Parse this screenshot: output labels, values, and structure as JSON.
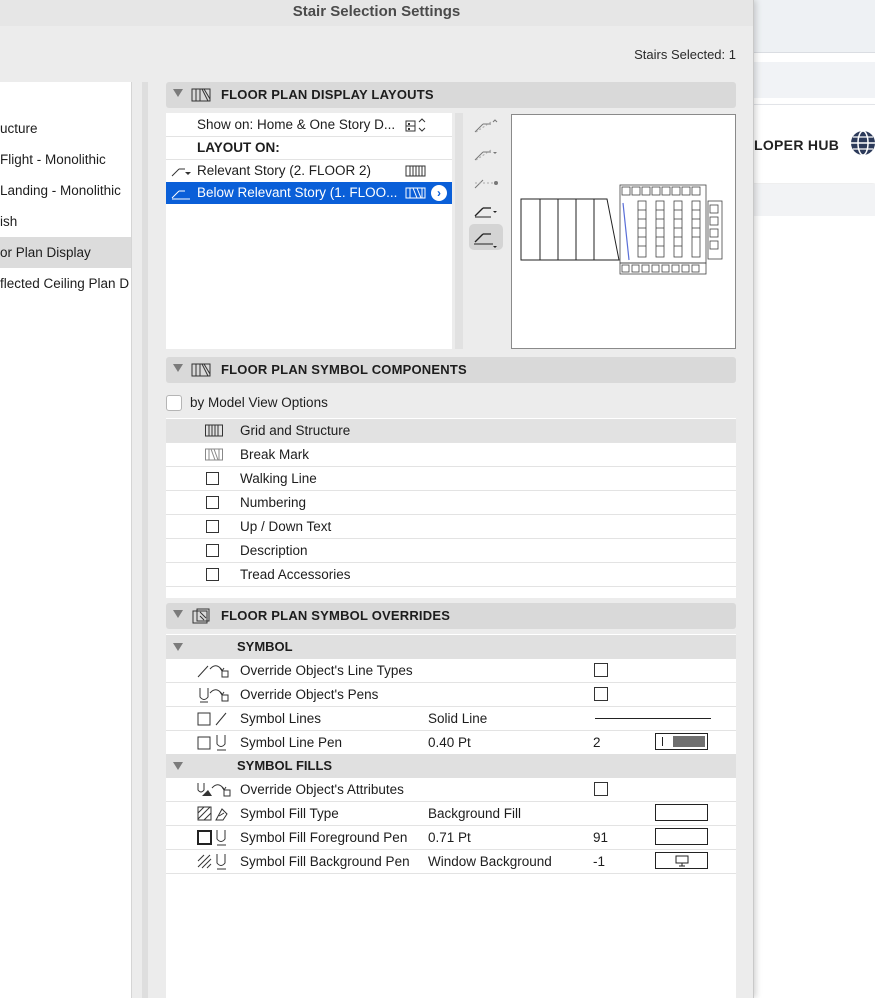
{
  "window": {
    "title": "Stair Selection Settings",
    "stairs_selected": "Stairs Selected: 1"
  },
  "background_app": {
    "hub_label": "LOPER HUB",
    "globe_icon": "globe-icon"
  },
  "nav": {
    "items": [
      {
        "label": "ucture"
      },
      {
        "label": "Flight - Monolithic"
      },
      {
        "label": "Landing - Monolithic"
      },
      {
        "label": "ish"
      },
      {
        "label": "or Plan Display"
      },
      {
        "label": "flected Ceiling Plan D"
      }
    ],
    "selected_index": 4
  },
  "display_layouts": {
    "header": "FLOOR PLAN DISPLAY LAYOUTS",
    "show_on": "Show on: Home & One Story D...",
    "layout_on": "LAYOUT ON:",
    "rows": [
      {
        "label": "Relevant Story (2. FLOOR 2)"
      },
      {
        "label": "Below Relevant Story (1. FLOO..."
      }
    ],
    "arrow_glyph": "›"
  },
  "symbol_components": {
    "header": "FLOOR PLAN SYMBOL COMPONENTS",
    "by_model_view": "by Model View Options",
    "items": [
      {
        "label": "Grid and Structure"
      },
      {
        "label": "Break Mark"
      },
      {
        "label": "Walking Line"
      },
      {
        "label": "Numbering"
      },
      {
        "label": "Up / Down Text"
      },
      {
        "label": "Description"
      },
      {
        "label": "Tread Accessories"
      }
    ]
  },
  "symbol_overrides": {
    "header": "FLOOR PLAN SYMBOL OVERRIDES",
    "symbol": {
      "title": "SYMBOL",
      "line_types": "Override Object's Line Types",
      "pens": "Override Object's Pens",
      "lines": {
        "label": "Symbol Lines",
        "value": "Solid Line"
      },
      "line_pen": {
        "label": "Symbol Line Pen",
        "value": "0.40 Pt",
        "num": "2"
      }
    },
    "fills": {
      "title": "SYMBOL FILLS",
      "attributes": "Override Object's Attributes",
      "fill_type": {
        "label": "Symbol Fill Type",
        "value": "Background Fill"
      },
      "fg_pen": {
        "label": "Symbol Fill Foreground Pen",
        "value": "0.71 Pt",
        "num": "91"
      },
      "bg_pen": {
        "label": "Symbol Fill Background Pen",
        "value": "Window Background",
        "num": "-1"
      }
    }
  },
  "colors": {
    "selection": "#0a5fd8",
    "header_bg": "#d9d9d9",
    "dialog_bg": "#ececec",
    "preview_blue": "#5a6fd8"
  }
}
